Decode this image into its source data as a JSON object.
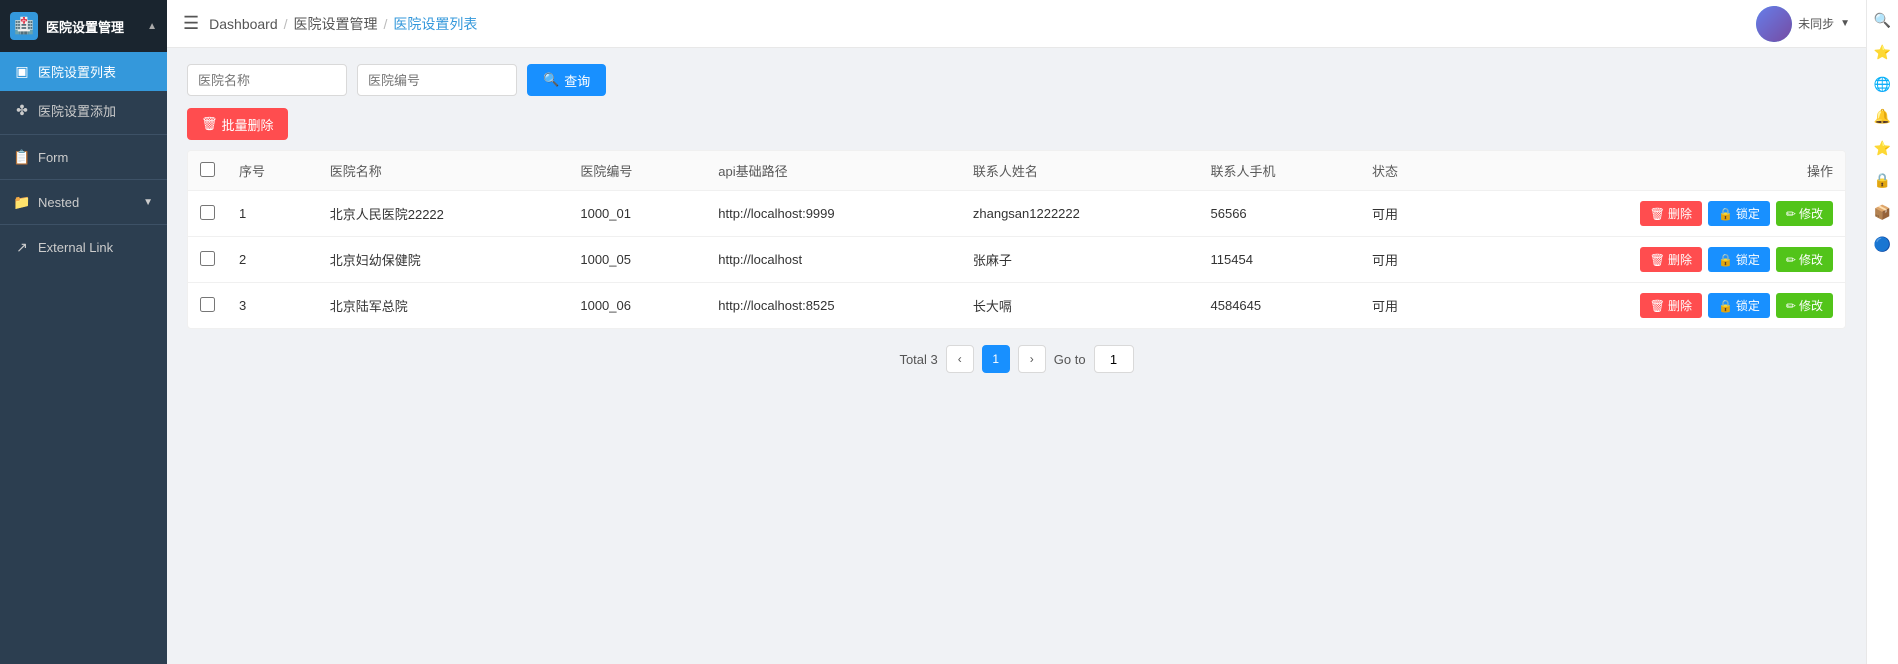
{
  "browser": {
    "url": "localhost:9529/#/hospSet/list"
  },
  "sidebar": {
    "title": "医院设置管理",
    "title_icon": "🏥",
    "items": [
      {
        "id": "hosp-list",
        "label": "医院设置列表",
        "icon": "▣",
        "active": true
      },
      {
        "id": "hosp-add",
        "label": "医院设置添加",
        "icon": "✤",
        "active": false
      }
    ],
    "form_label": "Form",
    "nested_label": "Nested",
    "external_label": "External Link"
  },
  "topbar": {
    "menu_icon": "☰",
    "breadcrumbs": [
      {
        "label": "Dashboard",
        "link": true
      },
      {
        "label": "医院设置管理",
        "link": true
      },
      {
        "label": "医院设置列表",
        "link": false
      }
    ],
    "avatar_label": "未同步"
  },
  "search": {
    "hospital_name_placeholder": "医院名称",
    "hospital_code_placeholder": "医院编号",
    "search_btn_label": "查询",
    "search_icon": "🔍"
  },
  "batch_delete": {
    "label": "批量删除"
  },
  "table": {
    "columns": [
      "",
      "序号",
      "医院名称",
      "医院编号",
      "api基础路径",
      "联系人姓名",
      "联系人手机",
      "状态",
      "操作"
    ],
    "rows": [
      {
        "id": 1,
        "index": "1",
        "name": "北京人民医院22222",
        "code": "1000_01",
        "api": "http://localhost:9999",
        "contact": "zhangsan1222222",
        "phone": "56566",
        "status": "可用"
      },
      {
        "id": 2,
        "index": "2",
        "name": "北京妇幼保健院",
        "code": "1000_05",
        "api": "http://localhost",
        "contact": "张麻子",
        "phone": "115454",
        "status": "可用"
      },
      {
        "id": 3,
        "index": "3",
        "name": "北京陆军总院",
        "code": "1000_06",
        "api": "http://localhost:8525",
        "contact": "长大嗝",
        "phone": "4584645",
        "status": "可用"
      }
    ],
    "action": {
      "delete": "删除",
      "lock": "锁定",
      "edit": "修改"
    }
  },
  "pagination": {
    "total_label": "Total 3",
    "current_page": "1",
    "goto_label": "Go to",
    "goto_value": "1"
  }
}
